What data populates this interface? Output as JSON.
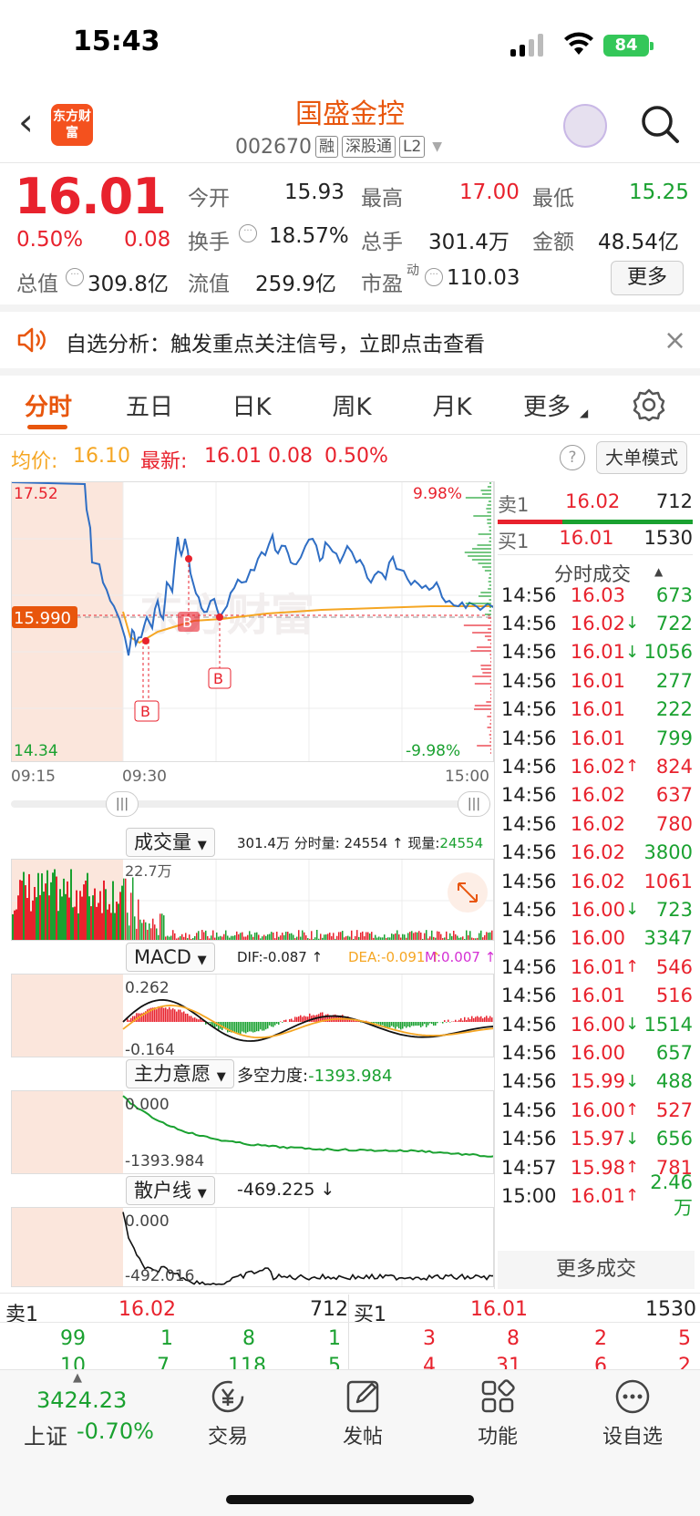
{
  "status": {
    "time": "15:43",
    "battery": "84"
  },
  "header": {
    "logo": "东方财富",
    "name": "国盛金控",
    "code": "002670",
    "tags": [
      "融",
      "深股通",
      "L2"
    ]
  },
  "quote": {
    "price": "16.01",
    "pct": "0.50%",
    "chg": "0.08",
    "open_label": "今开",
    "open": "15.93",
    "high_label": "最高",
    "high": "17.00",
    "low_label": "最低",
    "low": "15.25",
    "turnover_label": "换手",
    "turnover": "18.57%",
    "vol_label": "总手",
    "vol": "301.4万",
    "amt_label": "金额",
    "amt": "48.54亿",
    "mcap_label": "总值",
    "mcap": "309.8亿",
    "float_label": "流值",
    "float": "259.9亿",
    "pe_label": "市盈",
    "pe_sup": "动",
    "pe": "110.03",
    "more": "更多"
  },
  "banner": {
    "text": "自选分析：触发重点关注信号，立即点击查看"
  },
  "tabs": [
    "分时",
    "五日",
    "日K",
    "周K",
    "月K",
    "更多"
  ],
  "info": {
    "avg_label": "均价:",
    "avg": "16.10",
    "last_label": "最新:",
    "last": "16.01",
    "chg": "0.08",
    "pct": "0.50%",
    "big_order": "大单模式",
    "help": "?"
  },
  "chart": {
    "max": "17.52",
    "min": "14.34",
    "up": "9.98%",
    "down": "-9.98%",
    "cur": "15.990",
    "watermark": "东方财富",
    "t0": "09:15",
    "t1": "09:30",
    "t2": "15:00",
    "marker": "B",
    "grip": "|||"
  },
  "vol": {
    "label": "成交量",
    "summary_a": "301.4万 分时量: 24554 ↑ 现量:",
    "summary_b": "24554",
    "peak": "22.7万"
  },
  "macd": {
    "label": "MACD",
    "dif": "DIF:-0.087 ↑",
    "dea": "DEA:-0.091 ↑",
    "m": "M:0.007 ↑",
    "top": "0.262",
    "bot": "-0.164"
  },
  "main": {
    "label": "主力意愿",
    "desc": "多空力度:",
    "val": "-1393.984",
    "top": "0.000",
    "bot": "-1393.984"
  },
  "retail": {
    "label": "散户线",
    "val": "-469.225 ↓",
    "top": "0.000",
    "bot": "-492.016"
  },
  "orderbook": {
    "sell_label": "卖1",
    "sell_price": "16.02",
    "sell_vol": "712",
    "buy_label": "买1",
    "buy_price": "16.01",
    "buy_vol": "1530",
    "ticks_title": "分时成交",
    "more": "更多成交"
  },
  "ticks": [
    {
      "t": "14:56",
      "p": "16.03",
      "a": "",
      "v": "673",
      "pc": "red",
      "vc": "green"
    },
    {
      "t": "14:56",
      "p": "16.02",
      "a": "↓",
      "v": "722",
      "pc": "red",
      "vc": "green"
    },
    {
      "t": "14:56",
      "p": "16.01",
      "a": "↓",
      "v": "1056",
      "pc": "red",
      "vc": "green"
    },
    {
      "t": "14:56",
      "p": "16.01",
      "a": "",
      "v": "277",
      "pc": "red",
      "vc": "green"
    },
    {
      "t": "14:56",
      "p": "16.01",
      "a": "",
      "v": "222",
      "pc": "red",
      "vc": "green"
    },
    {
      "t": "14:56",
      "p": "16.01",
      "a": "",
      "v": "799",
      "pc": "red",
      "vc": "green"
    },
    {
      "t": "14:56",
      "p": "16.02",
      "a": "↑",
      "v": "824",
      "pc": "red",
      "vc": "red"
    },
    {
      "t": "14:56",
      "p": "16.02",
      "a": "",
      "v": "637",
      "pc": "red",
      "vc": "red"
    },
    {
      "t": "14:56",
      "p": "16.02",
      "a": "",
      "v": "780",
      "pc": "red",
      "vc": "red"
    },
    {
      "t": "14:56",
      "p": "16.02",
      "a": "",
      "v": "3800",
      "pc": "red",
      "vc": "green"
    },
    {
      "t": "14:56",
      "p": "16.02",
      "a": "",
      "v": "1061",
      "pc": "red",
      "vc": "red"
    },
    {
      "t": "14:56",
      "p": "16.00",
      "a": "↓",
      "v": "723",
      "pc": "red",
      "vc": "green"
    },
    {
      "t": "14:56",
      "p": "16.00",
      "a": "",
      "v": "3347",
      "pc": "red",
      "vc": "green"
    },
    {
      "t": "14:56",
      "p": "16.01",
      "a": "↑",
      "v": "546",
      "pc": "red",
      "vc": "red"
    },
    {
      "t": "14:56",
      "p": "16.01",
      "a": "",
      "v": "516",
      "pc": "red",
      "vc": "red"
    },
    {
      "t": "14:56",
      "p": "16.00",
      "a": "↓",
      "v": "1514",
      "pc": "red",
      "vc": "green"
    },
    {
      "t": "14:56",
      "p": "16.00",
      "a": "",
      "v": "657",
      "pc": "red",
      "vc": "green"
    },
    {
      "t": "14:56",
      "p": "15.99",
      "a": "↓",
      "v": "488",
      "pc": "red",
      "vc": "green"
    },
    {
      "t": "14:56",
      "p": "16.00",
      "a": "↑",
      "v": "527",
      "pc": "red",
      "vc": "red"
    },
    {
      "t": "14:56",
      "p": "15.97",
      "a": "↓",
      "v": "656",
      "pc": "red",
      "vc": "green"
    },
    {
      "t": "14:57",
      "p": "15.98",
      "a": "↑",
      "v": "781",
      "pc": "red",
      "vc": "red"
    },
    {
      "t": "15:00",
      "p": "16.01",
      "a": "↑",
      "v": "2.46万",
      "pc": "red",
      "vc": "green"
    }
  ],
  "book": {
    "sell_label": "卖1",
    "sell_price": "16.02",
    "sell_vol": "712",
    "buy_label": "买1",
    "buy_price": "16.01",
    "buy_vol": "1530",
    "left_row1": [
      "99",
      "1",
      "8",
      "1"
    ],
    "right_row1": [
      "3",
      "8",
      "2",
      "5"
    ],
    "left_row2": [
      "10",
      "7",
      "118",
      "5"
    ],
    "right_row2": [
      "4",
      "31",
      "6",
      "2"
    ]
  },
  "nav": {
    "index": "3424.23",
    "index_name": "上证",
    "index_pct": "-0.70%",
    "items": [
      "交易",
      "发帖",
      "功能",
      "设自选"
    ]
  },
  "colors": {
    "up": "#e8222d",
    "down": "#1aa130",
    "accent": "#e8560d",
    "avg_line": "#f5a623"
  }
}
